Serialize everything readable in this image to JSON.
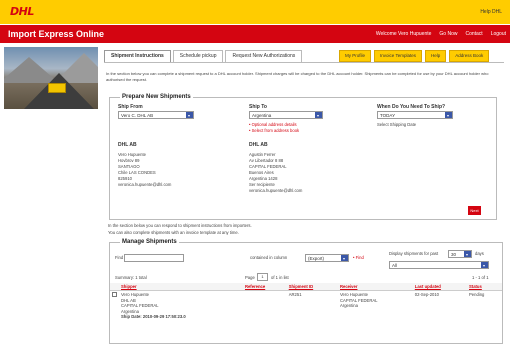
{
  "header": {
    "logo": "DHL",
    "top_right": "Help DHL"
  },
  "appbar": {
    "title": "Import Express Online",
    "links": [
      "Welcome Vero Hupuente",
      "Go Now",
      "Contact",
      "Logout"
    ]
  },
  "tabs": [
    "Shipment Instructions",
    "Schedule pickup",
    "Request New Authorizations"
  ],
  "right_buttons": [
    "My Profile",
    "Invoice Templates",
    "Help",
    "Address Book"
  ],
  "intro_text": "In the section below you can complete a shipment request to a DHL account holder. Shipment charges will be charged to the DHL account holder. Shipments can be completed for use by your DHL account holder who authorised the request.",
  "prepare": {
    "title": "Prepare New Shipments",
    "ship_from_label": "Ship From",
    "ship_from_value": "Vero C. DHL AB",
    "ship_to_label": "Ship To",
    "ship_to_value": "Argentina",
    "ship_to_link1": "• Optional address details",
    "ship_to_link2": "• Select from address book",
    "when_label": "When Do You Need To Ship?",
    "when_value": "TODAY",
    "when_note": "Select Shipping Date",
    "from_section": "DHL AB",
    "from_lines": [
      "Vero Hupuente",
      "Hovbrov 89",
      "SANTIAGO",
      "Chile LAS CONDES",
      "825910",
      "veronica.hupuente@dhl.com"
    ],
    "to_section": "DHL AB",
    "to_lines": [
      "Agustin Ferrer",
      "Av Libertador 8 88",
      "CAPITAL FEDERAL",
      "Buenos Aires",
      "Argentina 1428",
      "Ser recipiente",
      "veronica.hupuente@dhl.com"
    ],
    "next_label": "Next"
  },
  "mid_text1": "In the section below you can respond to shipment instructions from importers.",
  "mid_text2": "You can also complete shipments with an invoice template at any time.",
  "manage": {
    "title": "Manage Shipments",
    "find_label": "Find",
    "search_in_label": "contained in column",
    "search_col_value": "(Export)",
    "find_btn": "• Find",
    "display_label": "Display shipments for past",
    "display_value": "30",
    "days_label": "days",
    "all_value": "All",
    "summary_label": "Summary: 1 total",
    "page_label": "Page",
    "page_value": "1",
    "page_of": "of 1 in list",
    "range_label": "1 - 1 of 1",
    "columns": [
      "Shipper",
      "Reference",
      "Shipment ID",
      "Receiver",
      "Last updated",
      "Status"
    ],
    "rows": [
      {
        "shipper": [
          "Vero Hupuente",
          "DHL AB",
          "CAPITAL FEDERAL",
          "Argentina",
          "Ship Date: 2010-09-29 17:50:23.0"
        ],
        "reference": "",
        "shipment_id": "AR251",
        "receiver": [
          "Vero Hupuente",
          "CAPITAL FEDERAL",
          "Argentina"
        ],
        "last_updated": "02-Sep-2010",
        "status": "Pending"
      }
    ]
  }
}
